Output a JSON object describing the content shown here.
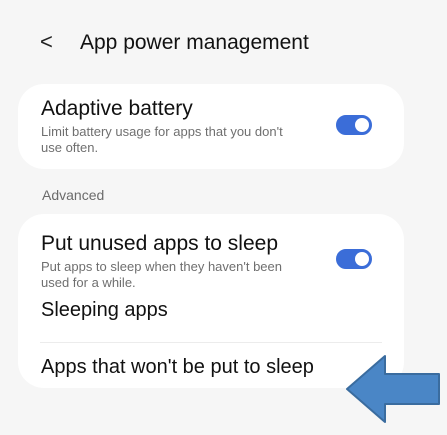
{
  "header": {
    "back_glyph": "<",
    "title": "App power management"
  },
  "adaptive_battery": {
    "title": "Adaptive battery",
    "description": "Limit battery usage for apps that you don't use often.",
    "toggle_on": true
  },
  "advanced_label": "Advanced",
  "put_unused": {
    "title": "Put unused apps to sleep",
    "description": "Put apps to sleep when they haven't been used for a while.",
    "toggle_on": true
  },
  "sleeping_apps": "Sleeping apps",
  "never_sleep": "Apps that won't be put to sleep",
  "colors": {
    "accent": "#3b6dd8",
    "annotation_arrow": "#4a86c6"
  },
  "icons": {
    "back": "chevron-left-icon",
    "annotation": "arrow-left-icon"
  }
}
